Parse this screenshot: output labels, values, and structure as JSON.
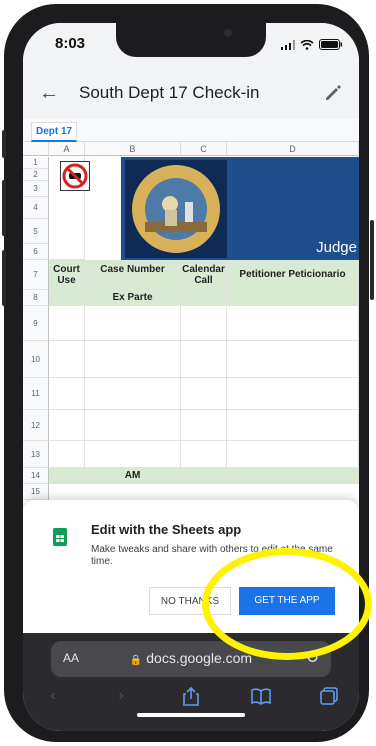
{
  "status_bar": {
    "time": "8:03"
  },
  "app_bar": {
    "title": "South Dept 17 Check-in"
  },
  "sheet_tab": {
    "label": "Dept 17"
  },
  "columns": [
    "A",
    "B",
    "C",
    "D"
  ],
  "rows": [
    "1",
    "2",
    "3",
    "4",
    "5",
    "6",
    "7",
    "8",
    "9",
    "10",
    "11",
    "12",
    "13",
    "14",
    "15"
  ],
  "header_row": {
    "court_use": "Court Use",
    "case_number": "Case Number",
    "calendar_call": "Calendar Call",
    "petitioner": "Petitioner Peticionario"
  },
  "banner": {
    "judge_text": "Judge"
  },
  "ex_parte": "Ex Parte",
  "am": "AM",
  "seal": {
    "top_text": "Superior Court of California",
    "bottom_text": "County of San Diego"
  },
  "sheets_prompt": {
    "title": "Edit with the Sheets app",
    "body": "Make tweaks and share with others to edit at the same time.",
    "no_thanks": "NO THANKS",
    "get_app": "GET THE APP"
  },
  "browser": {
    "aa": "AA",
    "url": "docs.google.com"
  },
  "colors": {
    "accent_blue": "#1a73e8",
    "banner_blue": "#1f4e8c",
    "header_green": "#d9ead3",
    "highlight_yellow": "#fff200"
  }
}
